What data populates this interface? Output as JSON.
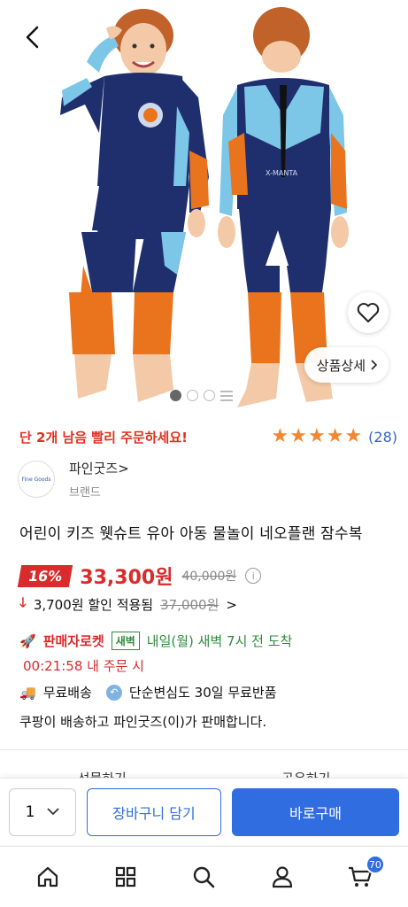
{
  "colors": {
    "accent_blue": "#2f6de1",
    "sale_red": "#d92b2b",
    "rocket_green": "#2f8a3d",
    "star_orange": "#f4862f",
    "suit_navy": "#1f2f6e",
    "suit_lightblue": "#7cc6e8",
    "suit_orange": "#e9741d"
  },
  "hero": {
    "suit_logo_text": "X-MANTA",
    "detail_button_label": "상품상세",
    "image_count_dots": 3,
    "active_dot": 1
  },
  "urgency": {
    "text": "단 2개 남음 빨리 주문하세요!"
  },
  "rating": {
    "stars": 5,
    "review_count": "(28)"
  },
  "seller": {
    "logo_text": "Fine Goods",
    "name": "파인굿즈>",
    "type": "브랜드"
  },
  "product": {
    "title": "어린이 키즈 웻슈트 유아 아동 물놀이 네오플랜 잠수복"
  },
  "price": {
    "discount": "16%",
    "sale_price": "33,300원",
    "original_price": "40,000원",
    "info_icon": "i"
  },
  "coupon": {
    "text": "3,700원 할인 적용됨",
    "original": "37,000원",
    "chevron": ">"
  },
  "rocket": {
    "label": "판매자로켓",
    "dawn_badge": "새벽",
    "arrival": "내일(월) 새벽 7시 전 도착",
    "countdown": "00:21:58 내 주문 시"
  },
  "shipping": {
    "free_shipping": "무료배송",
    "returns": "단순변심도 30일 무료반품"
  },
  "seller_info": "쿠팡이 배송하고 파인굿즈(이)가 판매합니다.",
  "partial_actions": [
    "선물하기",
    "공유하기"
  ],
  "purchase": {
    "quantity": "1",
    "cart_label": "장바구니 담기",
    "buy_label": "바로구매"
  },
  "nav": {
    "cart_badge": "70"
  }
}
